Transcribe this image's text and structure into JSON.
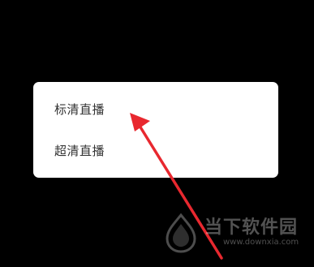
{
  "menu": {
    "items": [
      {
        "label": "标清直播"
      },
      {
        "label": "超清直播"
      }
    ]
  },
  "annotation": {
    "icon": "red-arrow-icon",
    "color": "#e8282f"
  },
  "watermark": {
    "title": "当下软件园",
    "url": "www.downxia.com",
    "icon": "downxia-logo-icon"
  },
  "colors": {
    "background": "#000000",
    "menu_background": "#ffffff",
    "menu_text": "#333333"
  }
}
